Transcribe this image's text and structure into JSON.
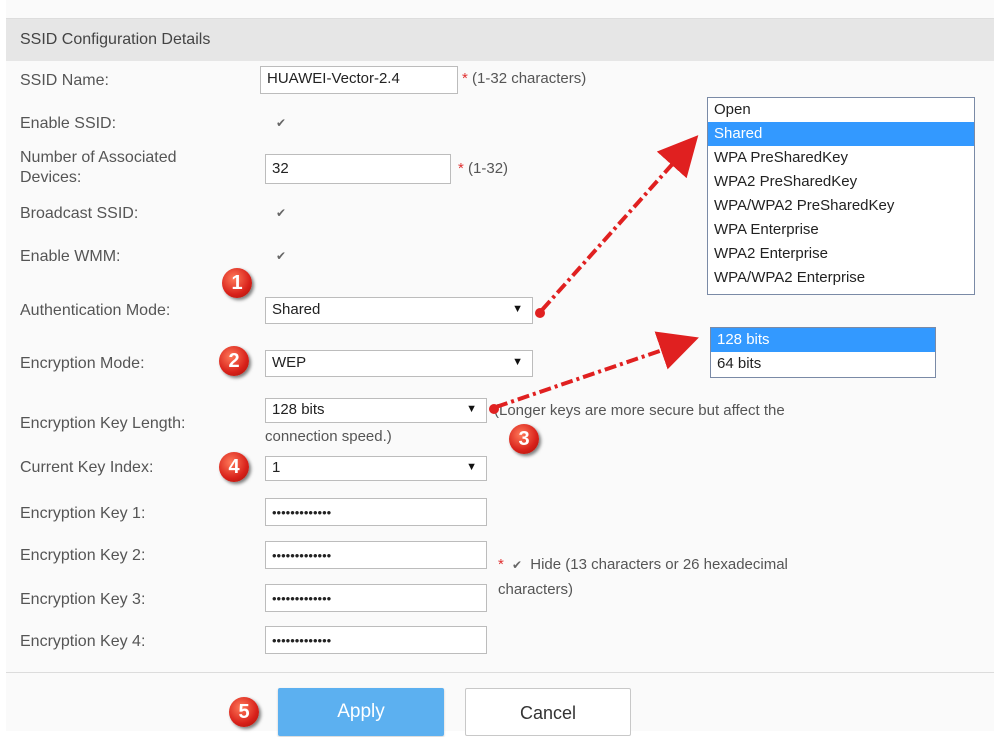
{
  "header": {
    "title": "SSID Configuration Details"
  },
  "ssid_name": {
    "label": "SSID Name:",
    "value": "HUAWEI-Vector-2.4",
    "hint": "(1-32 characters)",
    "required": "*"
  },
  "enable_ssid": {
    "label": "Enable SSID:",
    "checked": true
  },
  "assoc_devices": {
    "label_line1": "Number of Associated",
    "label_line2": "Devices:",
    "value": "32",
    "hint": "(1-32)",
    "required": "*"
  },
  "broadcast_ssid": {
    "label": "Broadcast SSID:",
    "checked": true
  },
  "enable_wmm": {
    "label": "Enable WMM:",
    "checked": true
  },
  "auth_mode": {
    "label": "Authentication Mode:",
    "selected": "Shared",
    "options": [
      "Open",
      "Shared",
      "WPA PreSharedKey",
      "WPA2 PreSharedKey",
      "WPA/WPA2 PreSharedKey",
      "WPA Enterprise",
      "WPA2 Enterprise",
      "WPA/WPA2 Enterprise"
    ],
    "highlighted": "Shared"
  },
  "enc_mode": {
    "label": "Encryption Mode:",
    "selected": "WEP"
  },
  "key_length": {
    "label": "Encryption Key Length:",
    "selected": "128 bits",
    "note_line1": "(Longer keys are more secure but affect the",
    "note_line2": "connection speed.)",
    "options": [
      "128 bits",
      "64 bits"
    ],
    "highlighted": "128 bits"
  },
  "key_index": {
    "label": "Current Key Index:",
    "selected": "1"
  },
  "keys": [
    {
      "label": "Encryption Key 1:",
      "value": "•••••••••••••"
    },
    {
      "label": "Encryption Key 2:",
      "value": "•••••••••••••"
    },
    {
      "label": "Encryption Key 3:",
      "value": "•••••••••••••"
    },
    {
      "label": "Encryption Key 4:",
      "value": "•••••••••••••"
    }
  ],
  "hide": {
    "required": "*",
    "label_line1": "Hide (13 characters or 26 hexadecimal",
    "label_line2": "characters)",
    "checked": true
  },
  "badges": [
    "1",
    "2",
    "3",
    "4",
    "5"
  ],
  "buttons": {
    "apply": "Apply",
    "cancel": "Cancel"
  },
  "icons": {
    "checkbox": "checkmark-icon",
    "select_arrow": "triangle-down-icon"
  },
  "colors": {
    "accent": "#3399ff",
    "apply_button": "#5cb0f0",
    "badge": "#d8211a",
    "arrow": "#e02020",
    "required": "#e03030"
  }
}
